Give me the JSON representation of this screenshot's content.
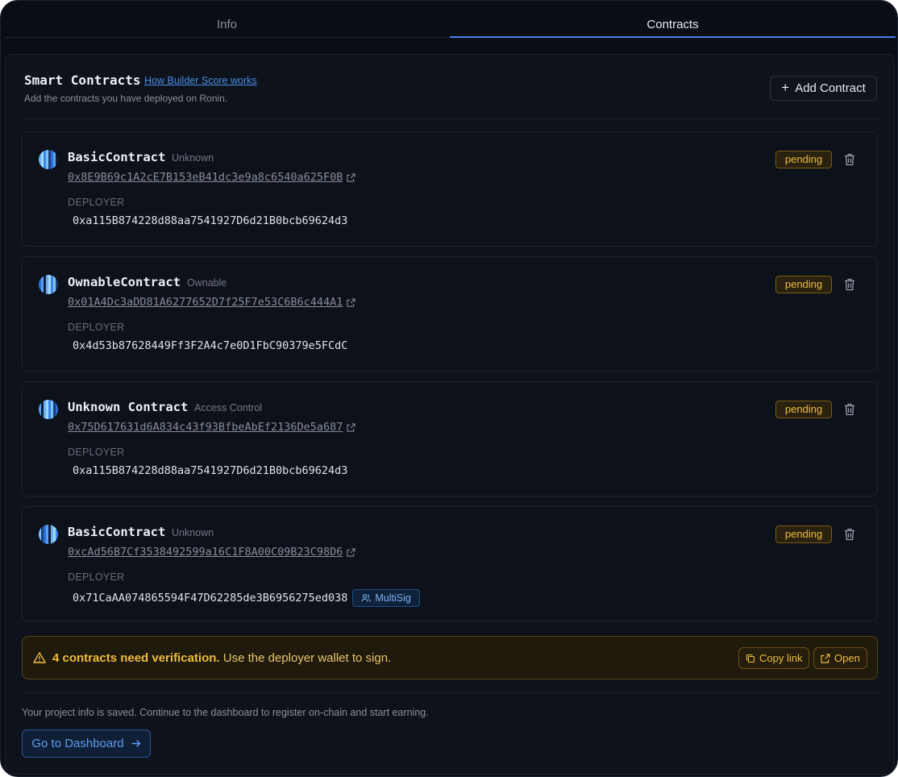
{
  "tabs": [
    {
      "label": "Info",
      "active": false
    },
    {
      "label": "Contracts",
      "active": true
    }
  ],
  "header": {
    "title": "Smart Contracts",
    "help_link": "How Builder Score works",
    "subtitle": "Add the contracts you have deployed on Ronin.",
    "add_button": "Add Contract"
  },
  "deployer_label": "DEPLOYER",
  "contracts": [
    {
      "name": "BasicContract",
      "type": "Unknown",
      "address": "0x8E9B69c1A2cE7B153eB41dc3e9a8c6540a625F0B",
      "deployer": "0xa115B874228d88aa7541927D6d21B0bcb69624d3",
      "status": "pending",
      "badge": ""
    },
    {
      "name": "OwnableContract",
      "type": "Ownable",
      "address": "0x01A4Dc3aDD81A6277652D7f25F7e53C6B6c444A1",
      "deployer": "0x4d53b87628449Ff3F2A4c7e0D1FbC90379e5FCdC",
      "status": "pending",
      "badge": ""
    },
    {
      "name": "Unknown Contract",
      "type": "Access Control",
      "address": "0x75D617631d6A834c43f93BfbeAbEf2136De5a687",
      "deployer": "0xa115B874228d88aa7541927D6d21B0bcb69624d3",
      "status": "pending",
      "badge": ""
    },
    {
      "name": "BasicContract",
      "type": "Unknown",
      "address": "0xcAd56B7Cf3538492599a16C1F8A00C09B23C98D6",
      "deployer": "0x71CaAA074865594F47D62285de3B6956275ed038",
      "status": "pending",
      "badge": "MultiSig"
    }
  ],
  "alert": {
    "strong": "4 contracts need verification.",
    "text": "Use the deployer wallet to sign.",
    "copy_button": "Copy link",
    "open_button": "Open"
  },
  "footer": {
    "text": "Your project info is saved. Continue to the dashboard to register on-chain and start earning.",
    "button": "Go to Dashboard"
  },
  "colors": {
    "accent": "#3d82ea",
    "pending": "#eebc3e",
    "background": "#0a0d14"
  }
}
